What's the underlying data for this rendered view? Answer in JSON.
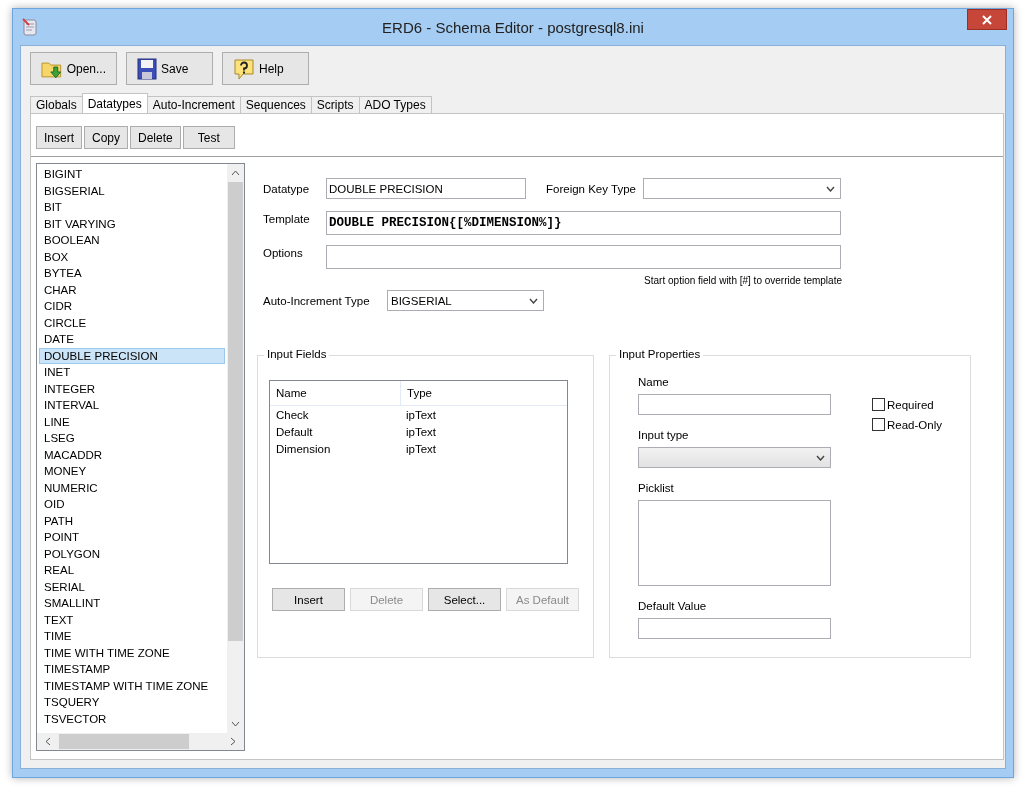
{
  "window": {
    "title": "ERD6 - Schema Editor - postgresql8.ini"
  },
  "toolbar": [
    {
      "label": "Open...",
      "kind": "open"
    },
    {
      "label": "Save",
      "kind": "save"
    },
    {
      "label": "Help",
      "kind": "help"
    }
  ],
  "tabs": [
    {
      "label": "Globals",
      "selected": false
    },
    {
      "label": "Datatypes",
      "selected": true
    },
    {
      "label": "Auto-Increment",
      "selected": false
    },
    {
      "label": "Sequences",
      "selected": false
    },
    {
      "label": "Scripts",
      "selected": false
    },
    {
      "label": "ADO Types",
      "selected": false
    }
  ],
  "actions": [
    "Insert",
    "Copy",
    "Delete",
    "Test"
  ],
  "datatypes": [
    {
      "label": "BIGINT",
      "selected": false
    },
    {
      "label": "BIGSERIAL",
      "selected": false
    },
    {
      "label": "BIT",
      "selected": false
    },
    {
      "label": "BIT VARYING",
      "selected": false
    },
    {
      "label": "BOOLEAN",
      "selected": false
    },
    {
      "label": "BOX",
      "selected": false
    },
    {
      "label": "BYTEA",
      "selected": false
    },
    {
      "label": "CHAR",
      "selected": false
    },
    {
      "label": "CIDR",
      "selected": false
    },
    {
      "label": "CIRCLE",
      "selected": false
    },
    {
      "label": "DATE",
      "selected": false
    },
    {
      "label": "DOUBLE PRECISION",
      "selected": true
    },
    {
      "label": "INET",
      "selected": false
    },
    {
      "label": "INTEGER",
      "selected": false
    },
    {
      "label": "INTERVAL",
      "selected": false
    },
    {
      "label": "LINE",
      "selected": false
    },
    {
      "label": "LSEG",
      "selected": false
    },
    {
      "label": "MACADDR",
      "selected": false
    },
    {
      "label": "MONEY",
      "selected": false
    },
    {
      "label": "NUMERIC",
      "selected": false
    },
    {
      "label": "OID",
      "selected": false
    },
    {
      "label": "PATH",
      "selected": false
    },
    {
      "label": "POINT",
      "selected": false
    },
    {
      "label": "POLYGON",
      "selected": false
    },
    {
      "label": "REAL",
      "selected": false
    },
    {
      "label": "SERIAL",
      "selected": false
    },
    {
      "label": "SMALLINT",
      "selected": false
    },
    {
      "label": "TEXT",
      "selected": false
    },
    {
      "label": "TIME",
      "selected": false
    },
    {
      "label": "TIME WITH TIME ZONE",
      "selected": false
    },
    {
      "label": "TIMESTAMP",
      "selected": false
    },
    {
      "label": "TIMESTAMP WITH TIME ZONE",
      "selected": false
    },
    {
      "label": "TSQUERY",
      "selected": false
    },
    {
      "label": "TSVECTOR",
      "selected": false
    }
  ],
  "form": {
    "datatype_label": "Datatype",
    "datatype_value": "DOUBLE PRECISION",
    "foreign_key_label": "Foreign Key Type",
    "template_label": "Template",
    "template_value": "DOUBLE PRECISION{[%DIMENSION%]}",
    "options_label": "Options",
    "options_hint": "Start option field with [#] to override template",
    "auto_increment_label": "Auto-Increment Type",
    "auto_increment_value": "BIGSERIAL"
  },
  "input_fields": {
    "title": "Input Fields",
    "columns": [
      "Name",
      "Type"
    ],
    "rows": [
      [
        "Check",
        "ipText"
      ],
      [
        "Default",
        "ipText"
      ],
      [
        "Dimension",
        "ipText"
      ]
    ],
    "buttons": [
      {
        "label": "Insert",
        "disabled": false
      },
      {
        "label": "Delete",
        "disabled": true
      },
      {
        "label": "Select...",
        "disabled": false
      },
      {
        "label": "As Default",
        "disabled": true
      }
    ]
  },
  "input_properties": {
    "title": "Input Properties",
    "name_label": "Name",
    "input_type_label": "Input type",
    "picklist_label": "Picklist",
    "default_value_label": "Default Value",
    "checkboxes": [
      {
        "label": "Required",
        "checked": false
      },
      {
        "label": "Read-Only",
        "checked": false
      }
    ]
  }
}
